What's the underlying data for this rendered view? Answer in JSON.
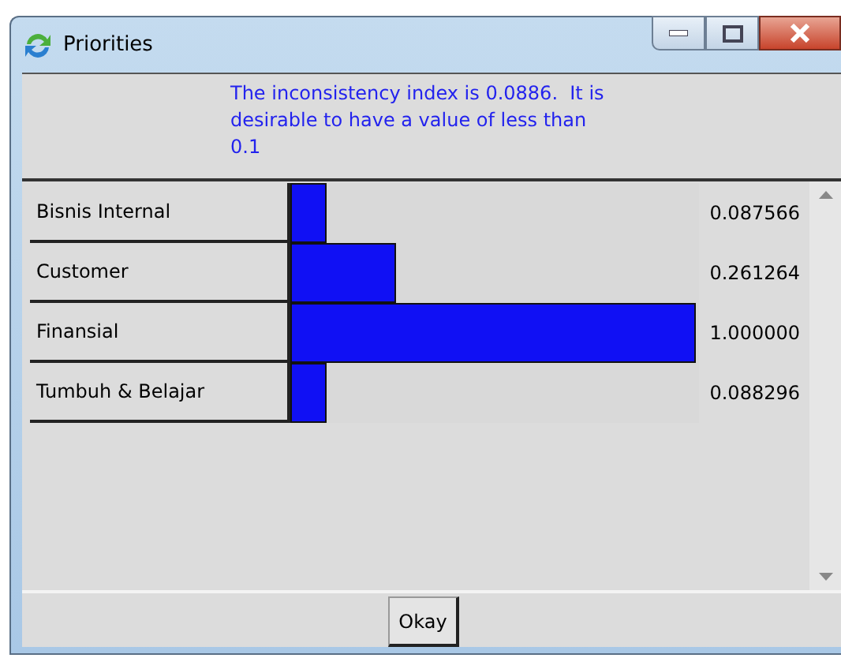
{
  "window": {
    "title": "Priorities"
  },
  "message": "The inconsistency index is 0.0886.  It is desirable to have a value of less than 0.1",
  "priorities": [
    {
      "name": "Bisnis Internal",
      "level": 0.087566,
      "value": "0.087566"
    },
    {
      "name": "Customer",
      "level": 0.261264,
      "value": "0.261264"
    },
    {
      "name": "Finansial",
      "level": 1.0,
      "value": "1.000000"
    },
    {
      "name": "Tumbuh & Belajar",
      "level": 0.088296,
      "value": "0.088296"
    }
  ],
  "buttons": [
    "Okay"
  ]
}
